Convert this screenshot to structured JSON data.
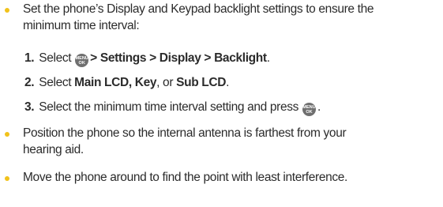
{
  "bullets": [
    {
      "line1": "Set the phone’s Display and Keypad backlight settings to ensure the",
      "line2": "minimum time interval:"
    },
    {
      "line1": "Position the phone so the internal antenna is farthest from your",
      "line2": "hearing aid."
    },
    {
      "line1": "Move the phone around to find the point with least interference."
    }
  ],
  "steps": [
    {
      "number": "1.",
      "pre": "Select ",
      "path": "> Settings > Display > Backlight",
      "post": "."
    },
    {
      "number": "2.",
      "pre": "Select ",
      "bold1": "Main LCD, Key",
      "mid1": ", or ",
      "bold2": "Sub LCD",
      "post": "."
    },
    {
      "number": "3.",
      "pre": "Select the minimum time interval setting and press ",
      "post": "."
    }
  ],
  "menu_key": {
    "top": "MENU",
    "bottom": "OK",
    "icon": "menu-ok-key-icon"
  },
  "colors": {
    "bullet": "#f1c21b",
    "text": "#2b2b2b",
    "key": "#6f6f6f"
  }
}
